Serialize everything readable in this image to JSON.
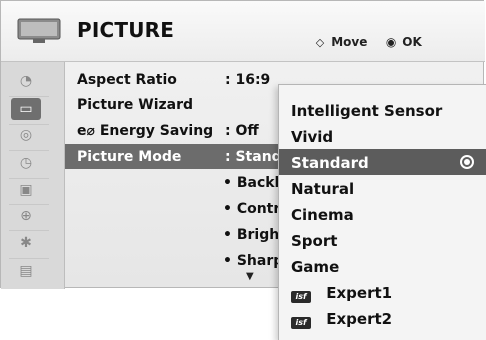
{
  "header": {
    "title": "PICTURE",
    "move_label": "Move",
    "ok_label": "OK"
  },
  "sidebar": {
    "items": [
      {
        "icon": "satellite-dish-icon"
      },
      {
        "icon": "tv-screen-icon",
        "active": true
      },
      {
        "icon": "speaker-icon"
      },
      {
        "icon": "clock-icon"
      },
      {
        "icon": "briefcase-icon"
      },
      {
        "icon": "lock-icon"
      },
      {
        "icon": "usb-icon"
      },
      {
        "icon": "clapperboard-icon"
      }
    ]
  },
  "menu": {
    "rows": [
      {
        "label": "Aspect Ratio",
        "value": ": 16:9"
      },
      {
        "label": "Picture Wizard",
        "value": ""
      },
      {
        "label_icon": "e⌀",
        "label": "Energy Saving",
        "value": ": Off"
      },
      {
        "label": "Picture Mode",
        "value": ": Standa",
        "selected": true
      }
    ],
    "sub_items": [
      "• Backlig",
      "• Contra",
      "• Brightn",
      "• Sharpn"
    ],
    "scroll_indicator": "▼"
  },
  "dropdown": {
    "options": [
      {
        "label": "Intelligent Sensor"
      },
      {
        "label": "Vivid"
      },
      {
        "label": "Standard",
        "selected": true
      },
      {
        "label": "Natural"
      },
      {
        "label": "Cinema"
      },
      {
        "label": "Sport"
      },
      {
        "label": "Game"
      },
      {
        "label": "Expert1",
        "badge": "isf"
      },
      {
        "label": "Expert2",
        "badge": "isf"
      }
    ]
  },
  "colors": {
    "selected_bg": "#6c6c6c",
    "selected_text": "#ffffff"
  }
}
